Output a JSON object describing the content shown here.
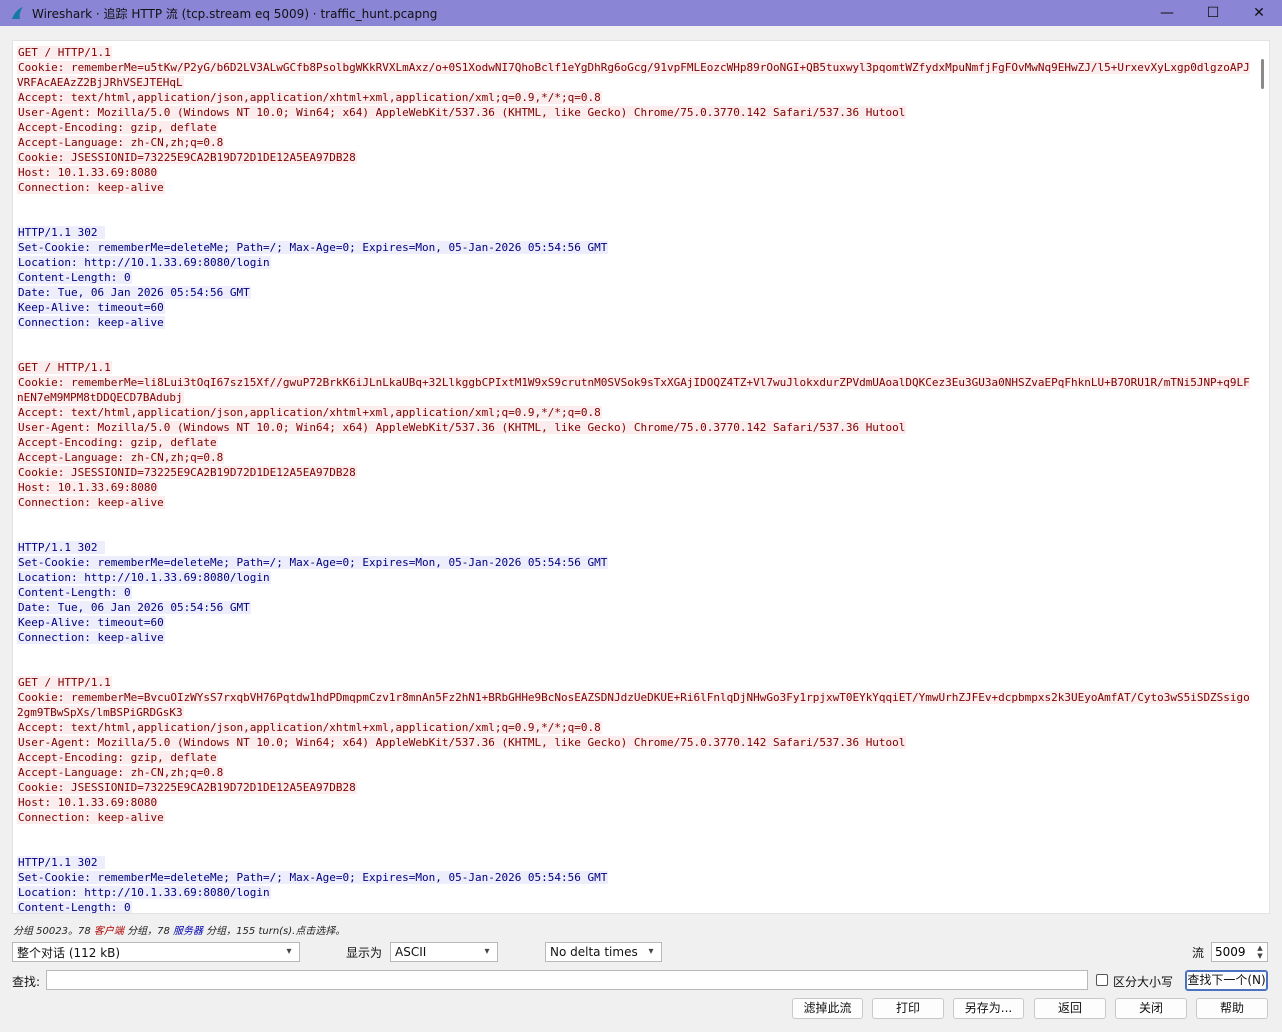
{
  "window": {
    "title": "Wireshark · 追踪 HTTP 流 (tcp.stream eq 5009) · traffic_hunt.pcapng",
    "minimize": "—",
    "maximize": "☐",
    "close": "✕"
  },
  "stream": {
    "blocks": [
      {
        "side": "client",
        "lines": [
          "GET / HTTP/1.1",
          "Cookie: rememberMe=u5tKw/P2yG/b6D2LV3ALwGCfb8PsolbgWKkRVXLmAxz/o+0S1XodwNI7QhoBclf1eYgDhRg6oGcg/91vpFMLEozcWHp89rOoNGI+QB5tuxwyl3pqomtWZfydxMpuNmfjFgFOvMwNq9EHwZJ/l5+UrxevXyLxgp0dlgzoAPJVRFAcAEAzZ2BjJRhVSEJTEHqL",
          "Accept: text/html,application/json,application/xhtml+xml,application/xml;q=0.9,*/*;q=0.8",
          "User-Agent: Mozilla/5.0 (Windows NT 10.0; Win64; x64) AppleWebKit/537.36 (KHTML, like Gecko) Chrome/75.0.3770.142 Safari/537.36 Hutool",
          "Accept-Encoding: gzip, deflate",
          "Accept-Language: zh-CN,zh;q=0.8",
          "Cookie: JSESSIONID=73225E9CA2B19D72D1DE12A5EA97DB28",
          "Host: 10.1.33.69:8080",
          "Connection: keep-alive"
        ]
      },
      {
        "side": "server",
        "lines": [
          "HTTP/1.1 302 ",
          "Set-Cookie: rememberMe=deleteMe; Path=/; Max-Age=0; Expires=Mon, 05-Jan-2026 05:54:56 GMT",
          "Location: http://10.1.33.69:8080/login",
          "Content-Length: 0",
          "Date: Tue, 06 Jan 2026 05:54:56 GMT",
          "Keep-Alive: timeout=60",
          "Connection: keep-alive"
        ]
      },
      {
        "side": "client",
        "lines": [
          "GET / HTTP/1.1",
          "Cookie: rememberMe=li8Lui3tOqI67sz15Xf//gwuP72BrkK6iJLnLkaUBq+32LlkggbCPIxtM1W9xS9crutnM0SVSok9sTxXGAjIDOQZ4TZ+Vl7wuJlokxdurZPVdmUAoalDQKCez3Eu3GU3a0NHSZvaEPqFhknLU+B7ORU1R/mTNi5JNP+q9LFnEN7eM9MPM8tDDQECD7BAdubj",
          "Accept: text/html,application/json,application/xhtml+xml,application/xml;q=0.9,*/*;q=0.8",
          "User-Agent: Mozilla/5.0 (Windows NT 10.0; Win64; x64) AppleWebKit/537.36 (KHTML, like Gecko) Chrome/75.0.3770.142 Safari/537.36 Hutool",
          "Accept-Encoding: gzip, deflate",
          "Accept-Language: zh-CN,zh;q=0.8",
          "Cookie: JSESSIONID=73225E9CA2B19D72D1DE12A5EA97DB28",
          "Host: 10.1.33.69:8080",
          "Connection: keep-alive"
        ]
      },
      {
        "side": "server",
        "lines": [
          "HTTP/1.1 302 ",
          "Set-Cookie: rememberMe=deleteMe; Path=/; Max-Age=0; Expires=Mon, 05-Jan-2026 05:54:56 GMT",
          "Location: http://10.1.33.69:8080/login",
          "Content-Length: 0",
          "Date: Tue, 06 Jan 2026 05:54:56 GMT",
          "Keep-Alive: timeout=60",
          "Connection: keep-alive"
        ]
      },
      {
        "side": "client",
        "lines": [
          "GET / HTTP/1.1",
          "Cookie: rememberMe=BvcuOIzWYsS7rxqbVH76Pqtdw1hdPDmqpmCzv1r8mnAn5Fz2hN1+BRbGHHe9BcNosEAZSDNJdzUeDKUE+Ri6lFnlqDjNHwGo3Fy1rpjxwT0EYkYqqiET/YmwUrhZJFEv+dcpbmpxs2k3UEyoAmfAT/Cyto3wS5iSDZSsigo2gm9TBwSpXs/lmBSPiGRDGsK3",
          "Accept: text/html,application/json,application/xhtml+xml,application/xml;q=0.9,*/*;q=0.8",
          "User-Agent: Mozilla/5.0 (Windows NT 10.0; Win64; x64) AppleWebKit/537.36 (KHTML, like Gecko) Chrome/75.0.3770.142 Safari/537.36 Hutool",
          "Accept-Encoding: gzip, deflate",
          "Accept-Language: zh-CN,zh;q=0.8",
          "Cookie: JSESSIONID=73225E9CA2B19D72D1DE12A5EA97DB28",
          "Host: 10.1.33.69:8080",
          "Connection: keep-alive"
        ]
      },
      {
        "side": "server",
        "lines": [
          "HTTP/1.1 302 ",
          "Set-Cookie: rememberMe=deleteMe; Path=/; Max-Age=0; Expires=Mon, 05-Jan-2026 05:54:56 GMT",
          "Location: http://10.1.33.69:8080/login",
          "Content-Length: 0"
        ]
      }
    ]
  },
  "summary": {
    "part1": "分组 50023。78 ",
    "client": "客户端",
    "part2": " 分组，78 ",
    "server": "服务器",
    "part3": " 分组，155 turn(s).点击选择。"
  },
  "controls": {
    "conversation": "整个对话 (112 kB)",
    "show_as_label": "显示为",
    "show_as": "ASCII",
    "delta": "No delta times",
    "stream_label": "流",
    "stream_value": "5009",
    "find_label": "查找:",
    "find_value": "",
    "case_label": "区分大小写",
    "find_next": "查找下一个(N)"
  },
  "buttons": {
    "filter_out": "滤掉此流",
    "print": "打印",
    "save_as": "另存为...",
    "back": "返回",
    "close": "关闭",
    "help": "帮助"
  }
}
